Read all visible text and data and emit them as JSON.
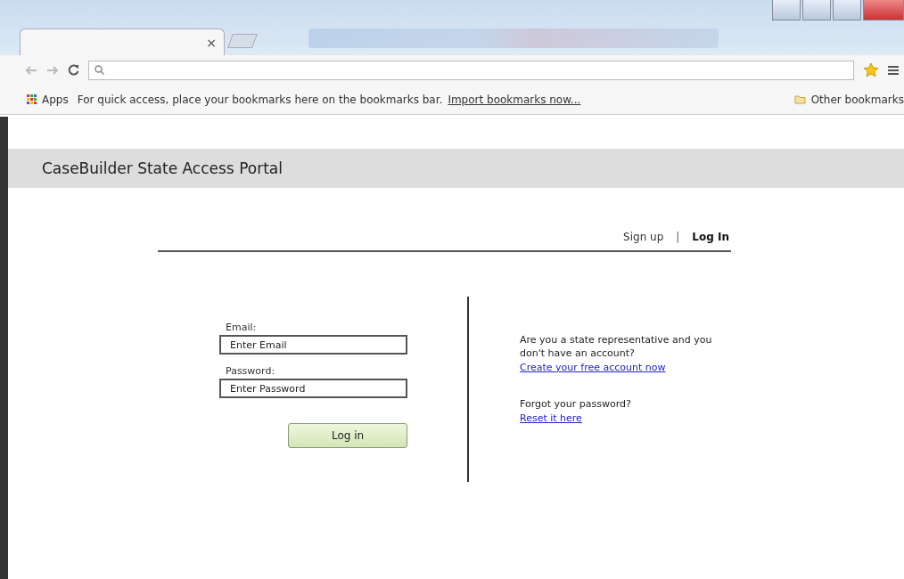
{
  "browser": {
    "tab_close": "×",
    "bookmarks_bar": {
      "apps": "Apps",
      "message": "For quick access, place your bookmarks here on the bookmarks bar.",
      "import_link": "Import bookmarks now...",
      "other": "Other bookmarks"
    }
  },
  "header": {
    "title": "CaseBuilder State Access Portal"
  },
  "nav": [
    {
      "label": "Sign up",
      "selected": false
    },
    {
      "label": "Log In",
      "selected": true
    }
  ],
  "nav_separator": "|",
  "form": {
    "fields": [
      {
        "label": "Email:",
        "placeholder": "Enter Email"
      },
      {
        "label": "Password:",
        "placeholder": "Enter Password"
      }
    ],
    "button": "Log in"
  },
  "side": [
    {
      "text": "Are you a state representative and you don't have an account?",
      "link": "Create your free account now"
    },
    {
      "text": "Forgot your password?",
      "link": "Reset it here"
    }
  ]
}
